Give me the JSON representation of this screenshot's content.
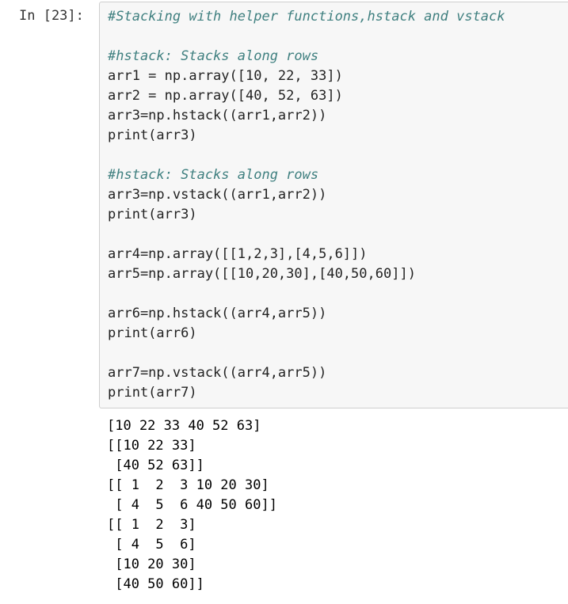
{
  "cell": {
    "prompt": "In [23]:",
    "code_lines": [
      {
        "text": "#Stacking with helper functions,hstack and vstack",
        "kind": "comment"
      },
      {
        "text": "",
        "kind": "blank"
      },
      {
        "text": "#hstack: Stacks along rows",
        "kind": "comment"
      },
      {
        "text": "arr1 = np.array([10, 22, 33])",
        "kind": "code"
      },
      {
        "text": "arr2 = np.array([40, 52, 63])",
        "kind": "code"
      },
      {
        "text": "arr3=np.hstack((arr1,arr2))",
        "kind": "code"
      },
      {
        "text": "print(arr3)",
        "kind": "code"
      },
      {
        "text": "",
        "kind": "blank"
      },
      {
        "text": "#hstack: Stacks along rows",
        "kind": "comment"
      },
      {
        "text": "arr3=np.vstack((arr1,arr2))",
        "kind": "code"
      },
      {
        "text": "print(arr3)",
        "kind": "code"
      },
      {
        "text": "",
        "kind": "blank"
      },
      {
        "text": "arr4=np.array([[1,2,3],[4,5,6]])",
        "kind": "code"
      },
      {
        "text": "arr5=np.array([[10,20,30],[40,50,60]])",
        "kind": "code"
      },
      {
        "text": "",
        "kind": "blank"
      },
      {
        "text": "arr6=np.hstack((arr4,arr5))",
        "kind": "code"
      },
      {
        "text": "print(arr6)",
        "kind": "code"
      },
      {
        "text": "",
        "kind": "blank"
      },
      {
        "text": "arr7=np.vstack((arr4,arr5))",
        "kind": "code"
      },
      {
        "text": "print(arr7)",
        "kind": "code"
      }
    ],
    "output_lines": [
      "[10 22 33 40 52 63]",
      "[[10 22 33]",
      " [40 52 63]]",
      "[[ 1  2  3 10 20 30]",
      " [ 4  5  6 40 50 60]]",
      "[[ 1  2  3]",
      " [ 4  5  6]",
      " [10 20 30]",
      " [40 50 60]]"
    ]
  },
  "colors": {
    "comment": "#408080",
    "code": "#222222",
    "input_background": "#f7f7f7",
    "input_border": "#cfcfcf",
    "prompt": "#333333"
  }
}
